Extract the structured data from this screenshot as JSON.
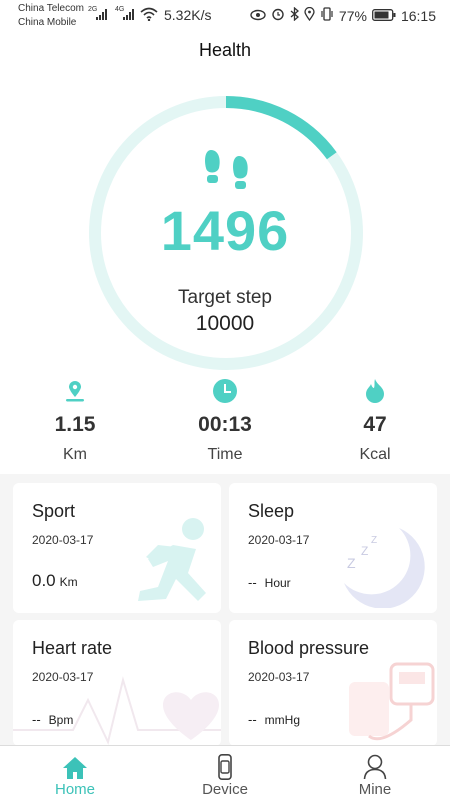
{
  "status_bar": {
    "carrier_1": "China Telecom",
    "carrier_2": "China Mobile",
    "net_1": "2G",
    "net_2": "4G",
    "speed": "5.32K/s",
    "battery": "77%",
    "time": "16:15"
  },
  "header": {
    "title": "Health"
  },
  "steps": {
    "count": "1496",
    "target_label": "Target step",
    "target_value": "10000",
    "progress_fraction": 0.1496
  },
  "metrics": [
    {
      "icon": "location-icon",
      "value": "1.15",
      "unit": "Km"
    },
    {
      "icon": "clock-icon",
      "value": "00:13",
      "unit": "Time"
    },
    {
      "icon": "flame-icon",
      "value": "47",
      "unit": "Kcal"
    }
  ],
  "cards": {
    "sport": {
      "title": "Sport",
      "date": "2020-03-17",
      "value": "0.0",
      "unit": "Km"
    },
    "sleep": {
      "title": "Sleep",
      "date": "2020-03-17",
      "value": "--",
      "unit": "Hour"
    },
    "heart": {
      "title": "Heart rate",
      "date": "2020-03-17",
      "value": "--",
      "unit": "Bpm"
    },
    "pressure": {
      "title": "Blood pressure",
      "date": "2020-03-17",
      "value": "--",
      "unit": "mmHg"
    }
  },
  "nav": [
    {
      "label": "Home",
      "icon": "home-icon",
      "active": true
    },
    {
      "label": "Device",
      "icon": "watch-icon",
      "active": false
    },
    {
      "label": "Mine",
      "icon": "person-icon",
      "active": false
    }
  ],
  "colors": {
    "accent": "#4fd0c4",
    "ring_track": "#e3f6f4"
  }
}
